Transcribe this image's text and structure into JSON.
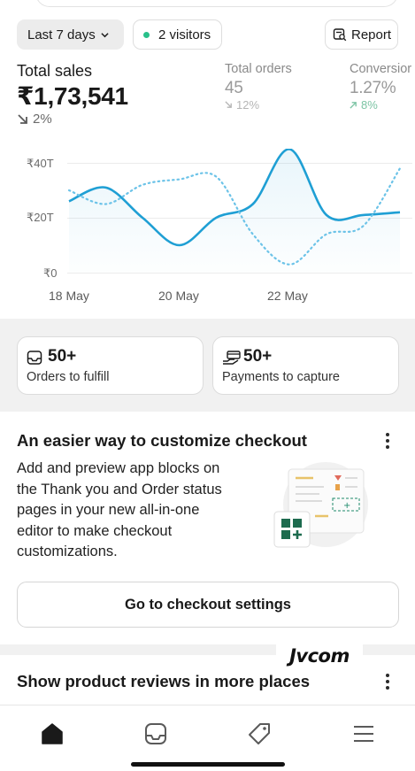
{
  "filters": {
    "range_label": "Last 7 days",
    "visitors_label": "2 visitors",
    "report_label": "Report",
    "visitor_dot_color": "#29c08a"
  },
  "metrics": {
    "total_sales": {
      "label": "Total sales",
      "value": "₹1,73,541",
      "delta": "2%",
      "direction": "down"
    },
    "total_orders": {
      "label": "Total orders",
      "value": "45",
      "delta": "12%",
      "direction": "down"
    },
    "conversion": {
      "label": "Conversior",
      "value": "1.27%",
      "delta": "8%",
      "direction": "up"
    }
  },
  "chart_data": {
    "type": "line",
    "y_ticks": [
      "₹40T",
      "₹20T",
      "₹0"
    ],
    "x_ticks": [
      "18 May",
      "20 May",
      "22 May"
    ],
    "ylim": [
      0,
      40
    ],
    "series": [
      {
        "style": "solid",
        "color": "#1f9fd4",
        "values": [
          26,
          31,
          20,
          10,
          20,
          25,
          45,
          21,
          21,
          22
        ]
      },
      {
        "style": "dotted",
        "color": "#6cc3e8",
        "values": [
          30,
          25,
          32,
          34,
          35,
          14,
          3,
          14,
          17,
          38
        ]
      }
    ]
  },
  "tasks": [
    {
      "count": "50+",
      "label": "Orders to fulfill",
      "icon": "inbox-icon"
    },
    {
      "count": "50+",
      "label": "Payments to capture",
      "icon": "payment-hand-icon"
    }
  ],
  "promo": {
    "title": "An easier way to customize checkout",
    "body": "Add and preview app blocks on the Thank you and Order status pages in your new all-in-one editor to make checkout customizations.",
    "button": "Go to checkout settings"
  },
  "watermark": "Jvcom",
  "card2": {
    "title": "Show product reviews in more places"
  },
  "nav": [
    "home-icon",
    "orders-inbox-icon",
    "products-tag-icon",
    "menu-icon"
  ]
}
